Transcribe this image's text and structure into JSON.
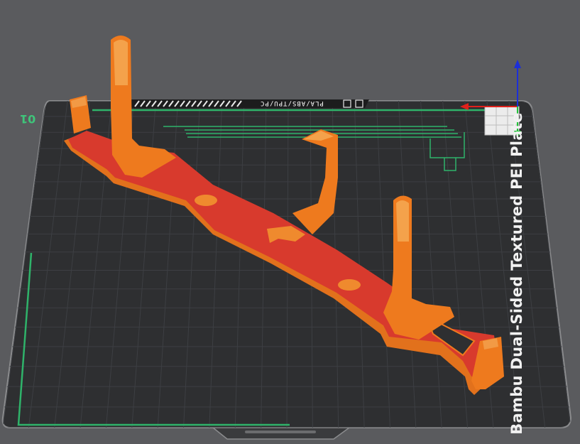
{
  "viewport": {
    "background_color": "#5a5b5e",
    "plate_color": "#2e2f31",
    "grid_color": "#3c3e41",
    "plate_edge_color": "#8b8c8e",
    "plate_number_color": "#3fc57a",
    "model_colors": {
      "top": "#d6372e",
      "side": "#ee7a1e",
      "dark": "#c8641a"
    }
  },
  "plate": {
    "name": "Bambu Dual-Sided Textured PEI Plate",
    "material_label": "PLA/ABS/TPU/PC",
    "number": "01"
  },
  "axes": {
    "x_color": "#e0211b",
    "y_color": "#22c43a",
    "z_color": "#1c2fd8"
  }
}
